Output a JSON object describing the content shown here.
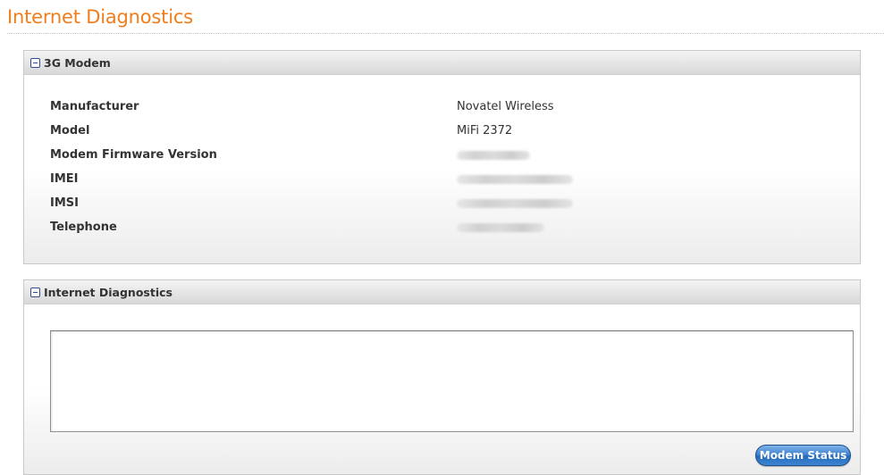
{
  "page": {
    "title": "Internet Diagnostics"
  },
  "modem_panel": {
    "title": "3G Modem",
    "rows": [
      {
        "label": "Manufacturer",
        "value": "Novatel Wireless",
        "redacted": false
      },
      {
        "label": "Model",
        "value": "MiFi 2372",
        "redacted": false
      },
      {
        "label": "Modem Firmware Version",
        "value": "",
        "redacted": true
      },
      {
        "label": "IMEI",
        "value": "",
        "redacted": true
      },
      {
        "label": "IMSI",
        "value": "",
        "redacted": true
      },
      {
        "label": "Telephone",
        "value": "",
        "redacted": true
      }
    ]
  },
  "diagnostics_panel": {
    "title": "Internet Diagnostics",
    "output_text": "",
    "button_label": "Modem Status"
  },
  "colors": {
    "title_orange": "#f07e1b",
    "button_blue": "#3f82cf",
    "icon_blue": "#2f4f8a"
  }
}
